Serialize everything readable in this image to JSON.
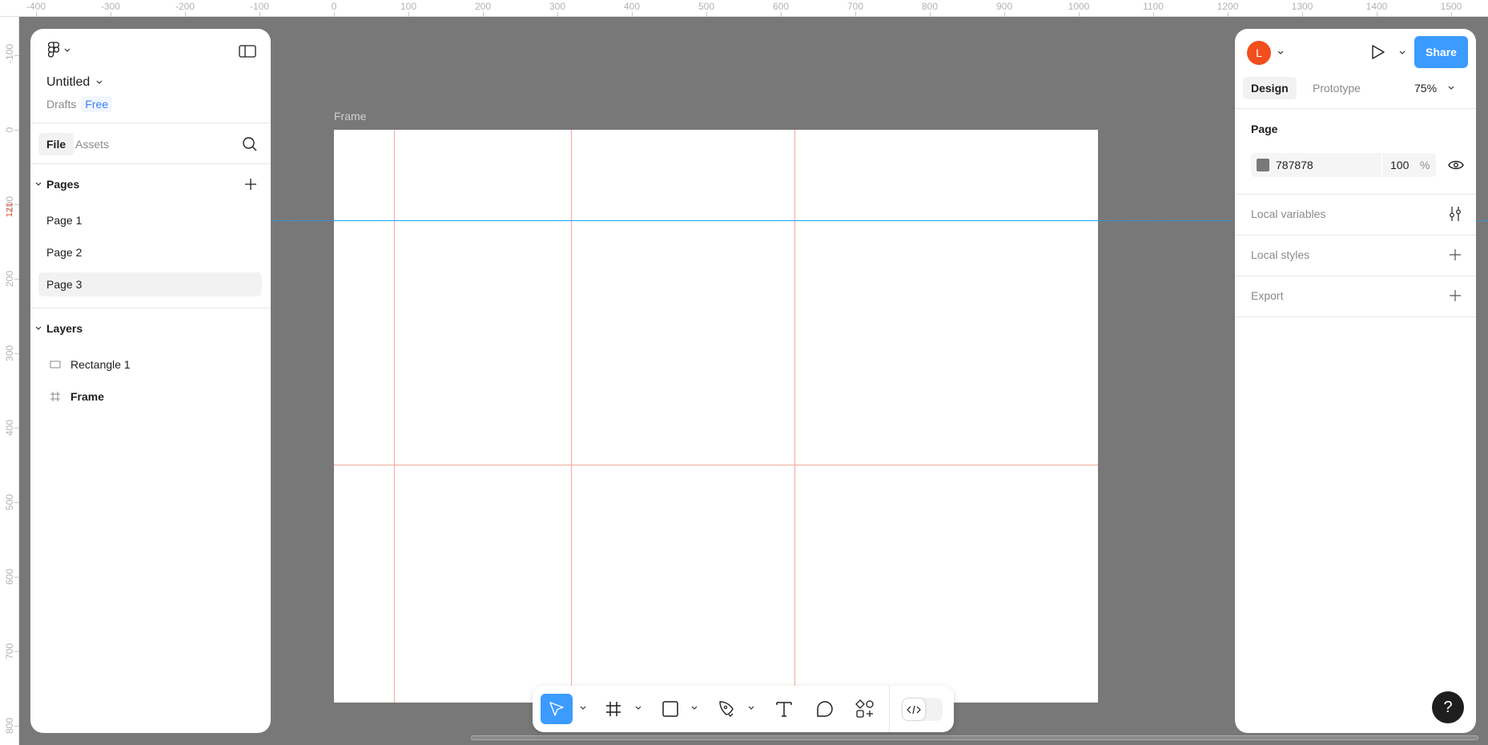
{
  "rulers": {
    "top_labels": [
      "-400",
      "-300",
      "-200",
      "-100",
      "0",
      "100",
      "200",
      "300",
      "400",
      "500",
      "600",
      "700",
      "800",
      "900",
      "1000",
      "1100",
      "1200",
      "1300",
      "1400",
      "1500"
    ],
    "left_labels": [
      "-100",
      "0",
      "100",
      "200",
      "300",
      "400",
      "500",
      "600",
      "700",
      "800"
    ],
    "selection_marker": "121"
  },
  "left_panel": {
    "file_name": "Untitled",
    "location": "Drafts",
    "plan": "Free",
    "tabs": [
      {
        "label": "File",
        "active": true
      },
      {
        "label": "Assets",
        "active": false
      }
    ],
    "pages_header": "Pages",
    "pages": [
      {
        "label": "Page 1"
      },
      {
        "label": "Page 2"
      },
      {
        "label": "Page 3",
        "selected": true
      }
    ],
    "layers_header": "Layers",
    "layers": [
      {
        "label": "Rectangle 1",
        "icon": "rectangle-icon"
      },
      {
        "label": "Frame",
        "icon": "frame-icon"
      }
    ]
  },
  "canvas": {
    "background": "#787878",
    "frame_label": "Frame",
    "guide_color": "#f3a89a",
    "selection_color": "#18a0fb"
  },
  "right_panel": {
    "avatar_initial": "L",
    "avatar_color": "#f24e1e",
    "share_label": "Share",
    "share_color": "#3b9bff",
    "tabs": [
      {
        "label": "Design",
        "active": true
      },
      {
        "label": "Prototype",
        "active": false
      }
    ],
    "zoom": "75%",
    "page_section": "Page",
    "page_fill_hex": "787878",
    "page_fill_opacity": "100",
    "percent_sign": "%",
    "sections": [
      {
        "label": "Local variables",
        "icon": "variables-icon"
      },
      {
        "label": "Local styles",
        "icon": "plus-icon"
      },
      {
        "label": "Export",
        "icon": "plus-icon"
      }
    ]
  },
  "toolbar": {
    "tools": [
      "move",
      "frame",
      "rectangle",
      "pen",
      "text",
      "comment",
      "actions"
    ],
    "active_tool": "move",
    "dev_mode_on": false
  },
  "help_label": "?"
}
